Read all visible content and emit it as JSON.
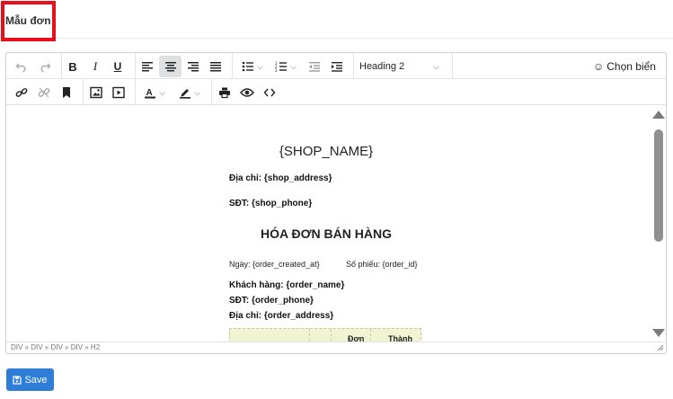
{
  "page": {
    "title": "Mẫu đơn"
  },
  "toolbar": {
    "undo_label": "Undo",
    "redo_label": "Redo",
    "bold_label": "B",
    "italic_label": "I",
    "underline_label": "U",
    "block_format_value": "Heading 2",
    "emoji_label": "Chọn biển",
    "icons": [
      "undo-icon",
      "redo-icon",
      "bold-icon",
      "italic-icon",
      "underline-icon",
      "align-left-icon",
      "align-center-icon",
      "align-right-icon",
      "align-justify-icon",
      "bullet-list-icon",
      "numbered-list-icon",
      "outdent-icon",
      "indent-icon",
      "link-icon",
      "unlink-icon",
      "bookmark-icon",
      "image-icon",
      "media-icon",
      "text-color-icon",
      "highlight-icon",
      "print-icon",
      "preview-icon",
      "code-icon",
      "smile-icon"
    ],
    "active_alignment": "center"
  },
  "document": {
    "shop_name": "{SHOP_NAME}",
    "address_line": "Địa chỉ: {shop_address}",
    "phone_line": "SĐT: {shop_phone}",
    "invoice_title": "HÓA ĐƠN BÁN HÀNG",
    "date_line": "Ngày: {order_created_at}",
    "receipt_line": "Số phiếu: {order_id}",
    "customer_line": "Khách hàng: {order_name}",
    "customer_phone_line": "SĐT: {order_phone}",
    "customer_address_line": "Địa chỉ: {order_address}",
    "table_headers": [
      "",
      "",
      "Đơn",
      "Thành"
    ]
  },
  "statusbar": {
    "path": "DIV » DIV » DIV » DIV » H2"
  },
  "actions": {
    "save_label": "Save"
  },
  "colors": {
    "highlight_border": "#e5101b",
    "save_button": "#2e7dd6",
    "table_fill": "#f1f3d3"
  }
}
